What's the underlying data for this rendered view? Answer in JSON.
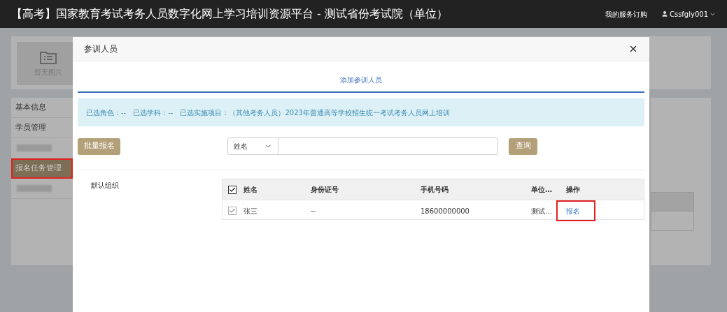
{
  "header": {
    "title": "【高考】国家教育考试考务人员数字化网上学习培训资源平台 - 测试省份考试院（单位）",
    "links": [
      {
        "label": "我的服务订购"
      }
    ],
    "user": {
      "name": "Cssfgly001"
    }
  },
  "background": {
    "image_placeholder": "暂无图片",
    "sidebar": [
      {
        "kind": "text",
        "label": "基本信息",
        "selected": false,
        "highlighted": false
      },
      {
        "kind": "text",
        "label": "学员管理",
        "selected": false,
        "highlighted": false
      },
      {
        "kind": "blurred"
      },
      {
        "kind": "text",
        "label": "报名任务管理",
        "selected": true,
        "highlighted": true
      },
      {
        "kind": "blurred"
      }
    ]
  },
  "modal": {
    "title": "参训人员",
    "tabs": [
      {
        "label": "添加参训人员",
        "selected": true
      }
    ],
    "filters": [
      {
        "label": "已选角色：",
        "value": "--"
      },
      {
        "label": "已选学科：",
        "value": "--"
      },
      {
        "label": "已选实施项目：",
        "value": "（其他考务人员）2023年普通高等学校招生统一考试考务人员网上培训"
      }
    ],
    "batch_button": "批量报名",
    "search": {
      "field": "姓名"
    },
    "query_button": "查询",
    "tree": [
      {
        "label": "默认组织"
      }
    ],
    "table": {
      "all_checked": true,
      "columns": [
        "姓名",
        "身份证号",
        "手机号码",
        "单位…",
        "操作"
      ],
      "rows": [
        {
          "checked": true,
          "cells": [
            "张三",
            "--",
            "18600000000",
            "测试…"
          ],
          "action": "报名",
          "highlighted": true
        }
      ]
    }
  }
}
